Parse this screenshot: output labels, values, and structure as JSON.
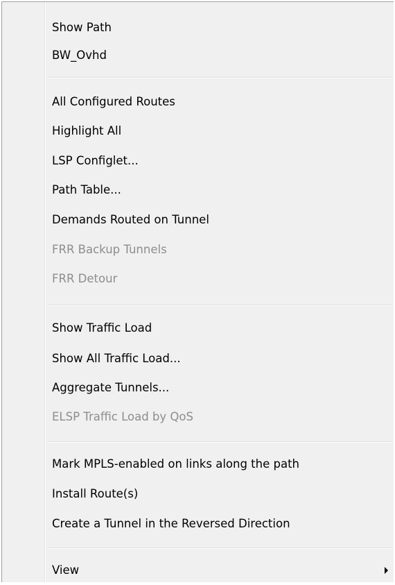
{
  "menu": {
    "groups": [
      {
        "items": [
          {
            "label": "Show Path",
            "enabled": true
          },
          {
            "label": "BW_Ovhd",
            "enabled": true
          }
        ]
      },
      {
        "items": [
          {
            "label": "All Configured Routes",
            "enabled": true
          },
          {
            "label": "Highlight All",
            "enabled": true
          },
          {
            "label": "LSP Configlet...",
            "enabled": true
          },
          {
            "label": "Path Table...",
            "enabled": true
          },
          {
            "label": "Demands Routed on Tunnel",
            "enabled": true
          },
          {
            "label": "FRR Backup Tunnels",
            "enabled": false
          },
          {
            "label": "FRR Detour",
            "enabled": false
          }
        ]
      },
      {
        "items": [
          {
            "label": "Show Traffic Load",
            "enabled": true
          },
          {
            "label": "Show All Traffic Load...",
            "enabled": true
          },
          {
            "label": "Aggregate Tunnels...",
            "enabled": true
          },
          {
            "label": "ELSP Traffic Load by QoS",
            "enabled": false
          }
        ]
      },
      {
        "items": [
          {
            "label": "Mark MPLS-enabled on links along the path",
            "enabled": true
          },
          {
            "label": "Install Route(s)",
            "enabled": true
          },
          {
            "label": "Create a Tunnel in the Reversed Direction",
            "enabled": true
          }
        ]
      },
      {
        "items": [
          {
            "label": "View",
            "enabled": true,
            "submenu": true,
            "icon": "chevron-right-icon"
          }
        ]
      }
    ],
    "colors": {
      "background": "#f0f0f0",
      "enabled_text": "#000000",
      "disabled_text": "#8d8d8d",
      "separator": "#e0e0e0",
      "border": "#a0a0a0"
    }
  }
}
